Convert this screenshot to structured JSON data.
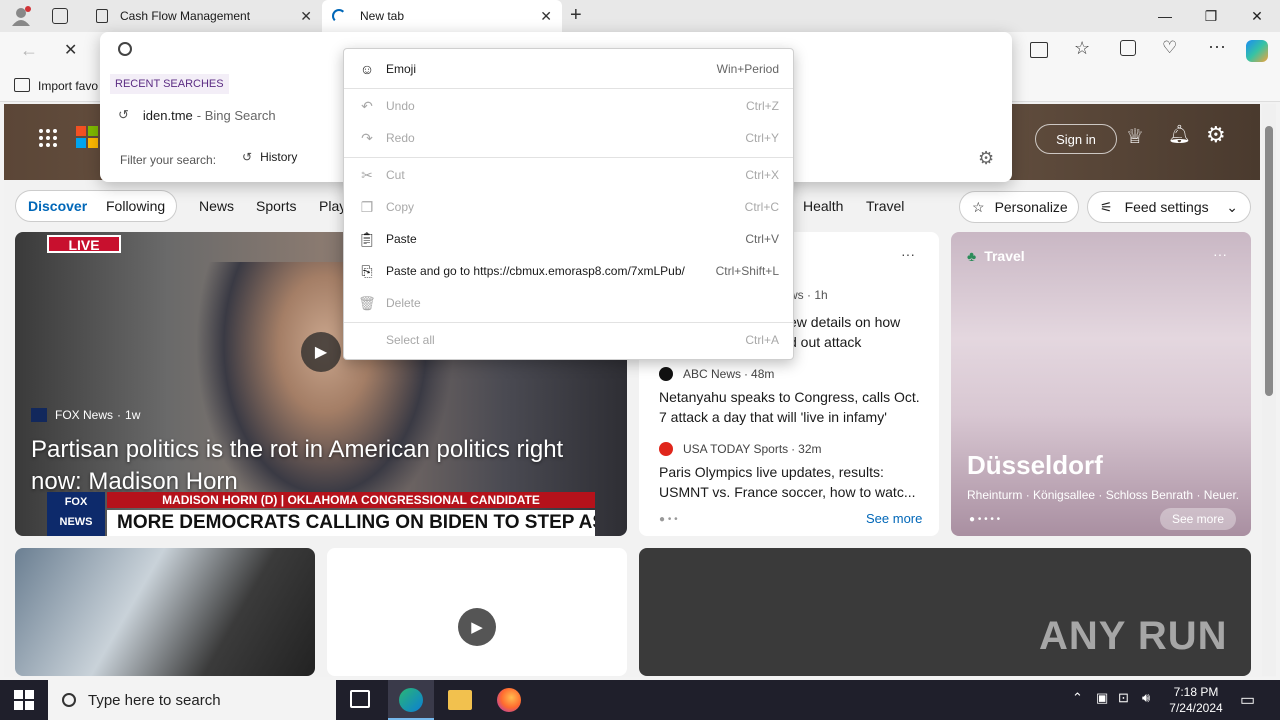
{
  "browser": {
    "tabs": [
      {
        "title": "Cash Flow Management"
      },
      {
        "title": "New tab"
      }
    ],
    "favorites_label": "Import favo"
  },
  "suggest": {
    "recent_header": "RECENT SEARCHES",
    "recent_item": "iden.tme",
    "recent_item_suffix": "- Bing Search",
    "filter_label": "Filter your search:",
    "filter_history": "History"
  },
  "context_menu": {
    "items": [
      {
        "label": "Emoji",
        "shortcut": "Win+Period",
        "enabled": true
      },
      {
        "label": "Undo",
        "shortcut": "Ctrl+Z",
        "enabled": false
      },
      {
        "label": "Redo",
        "shortcut": "Ctrl+Y",
        "enabled": false
      },
      {
        "label": "Cut",
        "shortcut": "Ctrl+X",
        "enabled": false
      },
      {
        "label": "Copy",
        "shortcut": "Ctrl+C",
        "enabled": false
      },
      {
        "label": "Paste",
        "shortcut": "Ctrl+V",
        "enabled": true
      },
      {
        "label": "Paste and go to https://cbmux.emorasp8.com/7xmLPub/",
        "shortcut": "Ctrl+Shift+L",
        "enabled": true
      },
      {
        "label": "Delete",
        "shortcut": "",
        "enabled": false
      },
      {
        "label": "Select all",
        "shortcut": "Ctrl+A",
        "enabled": false
      }
    ]
  },
  "header": {
    "sign_in": "Sign in"
  },
  "feed_nav": {
    "discover": "Discover",
    "following": "Following",
    "links": [
      "News",
      "Sports",
      "Play"
    ],
    "links_right": [
      "Health",
      "Travel"
    ],
    "personalize": "Personalize",
    "feed_settings": "Feed settings"
  },
  "main_story": {
    "source": "FOX News",
    "age": "1w",
    "headline": "Partisan politics is the rot in American politics right now: Madison Horn",
    "banner": "MADISON HORN (D) | OKLAHOMA CONGRESSIONAL CANDIDATE",
    "ticker": "MORE DEMOCRATS CALLING ON BIDEN TO STEP ASIDE",
    "live": "LIVE"
  },
  "news_card": {
    "top_meta": "ws · 1h",
    "top_headline_1": "ew details on how",
    "top_headline_2": "d out attack",
    "items": [
      {
        "source": "ABC News",
        "age": "48m",
        "headline": "Netanyahu speaks to Congress, calls Oct. 7 attack a day that will 'live in infamy'"
      },
      {
        "source": "USA TODAY Sports",
        "age": "32m",
        "headline": "Paris Olympics live updates, results: USMNT vs. France soccer, how to watc..."
      }
    ],
    "see_more": "See more"
  },
  "travel_card": {
    "label": "Travel",
    "city": "Düsseldorf",
    "places": "Rheinturm · Königsallee · Schloss Benrath · Neuer...",
    "see_more": "See more"
  },
  "watermark": "ANY RUN",
  "taskbar": {
    "search_placeholder": "Type here to search",
    "time": "7:18 PM",
    "date": "7/24/2024"
  },
  "colors": {
    "accent": "#0067b8",
    "taskbar": "#1f1f2b",
    "usa_today": "#e0261b"
  }
}
